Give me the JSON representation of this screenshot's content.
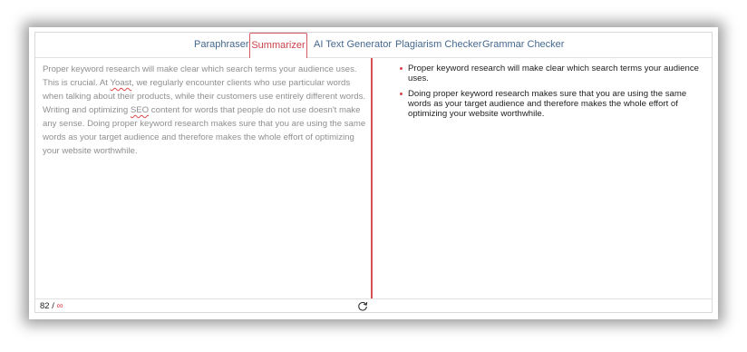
{
  "tabs": [
    {
      "label": "Paraphraser",
      "active": false
    },
    {
      "label": "Summarizer",
      "active": true
    },
    {
      "label": "AI Text Generator",
      "active": false
    },
    {
      "label": "Plagiarism Checker",
      "active": false
    },
    {
      "label": "Grammar Checker",
      "active": false
    }
  ],
  "input": {
    "text_part1": "Proper keyword research will make clear which search terms your audience uses. This is crucial. At ",
    "word_yoast": "Yoast",
    "text_part2": ", we regularly encounter clients who use particular words when talking about their products, while their customers use entirely different words. Writing and optimizing ",
    "word_seo": "SEO",
    "text_part3": " content for words that people do not use doesn't make any sense. Doing proper keyword research makes sure that you are using the same words as your target audience and therefore makes the whole effort of optimizing your website worthwhile."
  },
  "summary": {
    "items": [
      "Proper keyword research will make clear which search terms your audience uses.",
      "Doing proper keyword research makes sure that you are using the same words as your target audience and therefore makes the whole effort of optimizing your website worthwhile."
    ]
  },
  "footer": {
    "word_count": "82 / ",
    "limit_symbol": "∞"
  },
  "colors": {
    "accent": "#d64f57",
    "tab_text": "#44688f",
    "input_text": "#8f8f8f",
    "output_text": "#1f1f1f"
  },
  "icons": {
    "reset": "refresh-icon",
    "bullet": "bullet-dot"
  }
}
